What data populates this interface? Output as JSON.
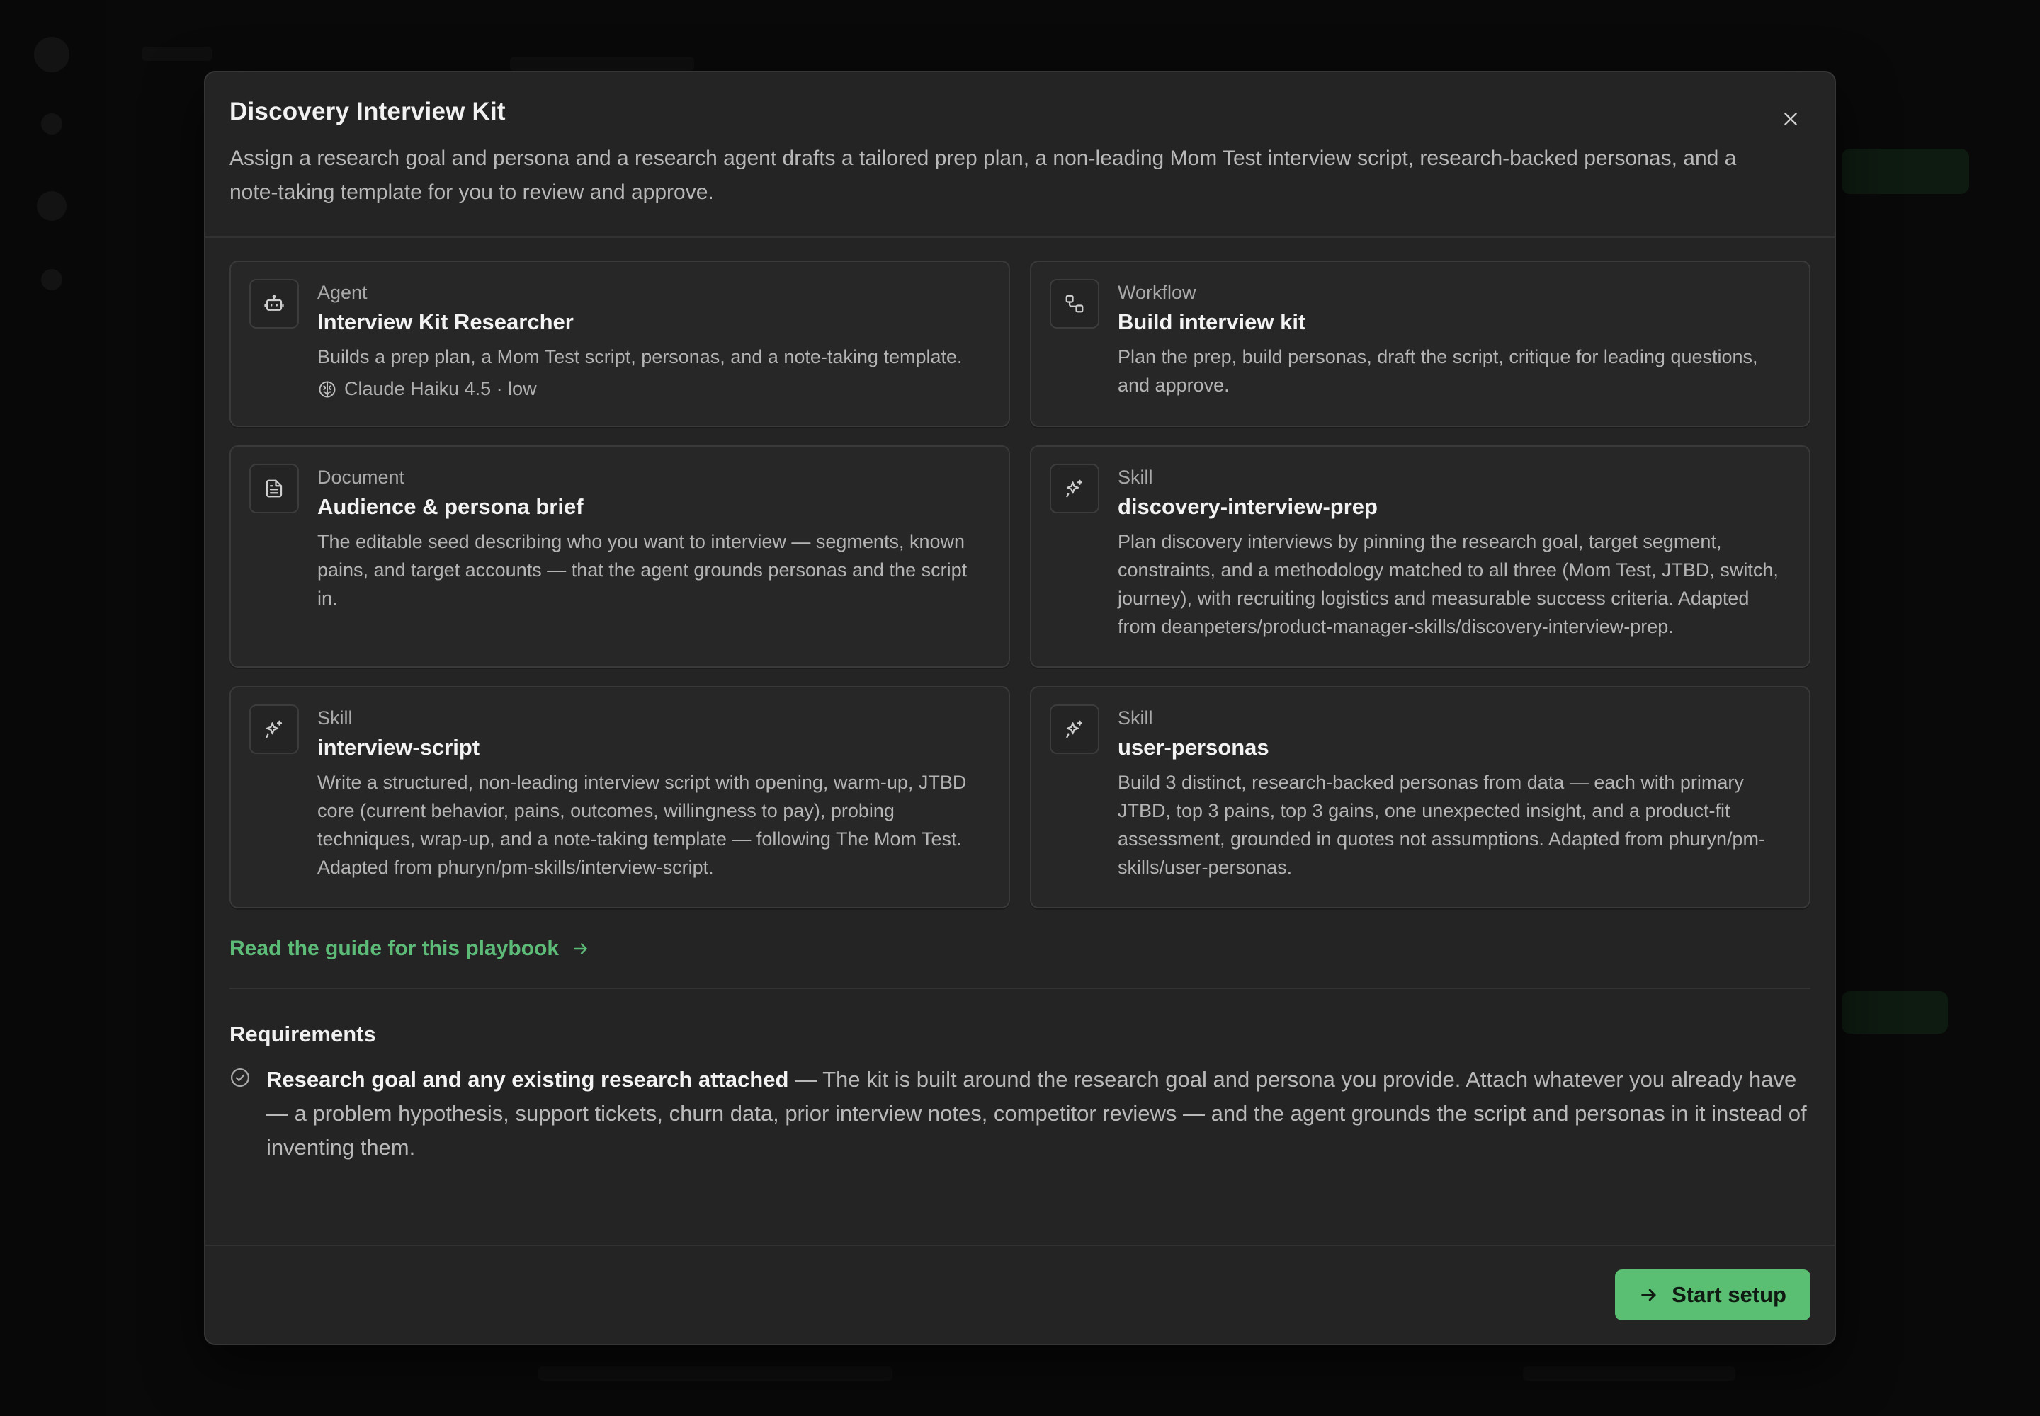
{
  "modal": {
    "title": "Discovery Interview Kit",
    "description": "Assign a research goal and persona and a research agent drafts a tailored prep plan, a non-leading Mom Test interview script, research-backed personas, and a note-taking template for you to review and approve.",
    "close_icon": "close-icon"
  },
  "cards": [
    {
      "icon": "agent-robot-icon",
      "kind": "Agent",
      "name": "Interview Kit Researcher",
      "description": "Builds a prep plan, a Mom Test script, personas, and a note-taking template.",
      "meta": "Claude Haiku 4.5 · low"
    },
    {
      "icon": "workflow-icon",
      "kind": "Workflow",
      "name": "Build interview kit",
      "description": "Plan the prep, build personas, draft the script, critique for leading questions, and approve."
    },
    {
      "icon": "document-icon",
      "kind": "Document",
      "name": "Audience & persona brief",
      "description": "The editable seed describing who you want to interview — segments, known pains, and target accounts — that the agent grounds personas and the script in."
    },
    {
      "icon": "sparkle-icon",
      "kind": "Skill",
      "name": "discovery-interview-prep",
      "description": "Plan discovery interviews by pinning the research goal, target segment, constraints, and a methodology matched to all three (Mom Test, JTBD, switch, journey), with recruiting logistics and measurable success criteria. Adapted from deanpeters/product-manager-skills/discovery-interview-prep."
    },
    {
      "icon": "sparkle-icon",
      "kind": "Skill",
      "name": "interview-script",
      "description": "Write a structured, non-leading interview script with opening, warm-up, JTBD core (current behavior, pains, outcomes, willingness to pay), probing techniques, wrap-up, and a note-taking template — following The Mom Test. Adapted from phuryn/pm-skills/interview-script."
    },
    {
      "icon": "sparkle-icon",
      "kind": "Skill",
      "name": "user-personas",
      "description": "Build 3 distinct, research-backed personas from data — each with primary JTBD, top 3 pains, top 3 gains, one unexpected insight, and a product-fit assessment, grounded in quotes not assumptions. Adapted from phuryn/pm-skills/user-personas."
    }
  ],
  "guide_link": "Read the guide for this playbook",
  "requirements": {
    "title": "Requirements",
    "items": [
      {
        "name": "Research goal and any existing research attached",
        "description": " — The kit is built around the research goal and persona you provide. Attach whatever you already have — a problem hypothesis, support tickets, churn data, prior interview notes, competitor reviews — and the agent grounds the script and personas in it instead of inventing them."
      }
    ]
  },
  "footer": {
    "start_label": "Start setup"
  },
  "colors": {
    "accent": "#5bbf73",
    "link": "#5dbb78",
    "modal_bg": "#242424"
  }
}
